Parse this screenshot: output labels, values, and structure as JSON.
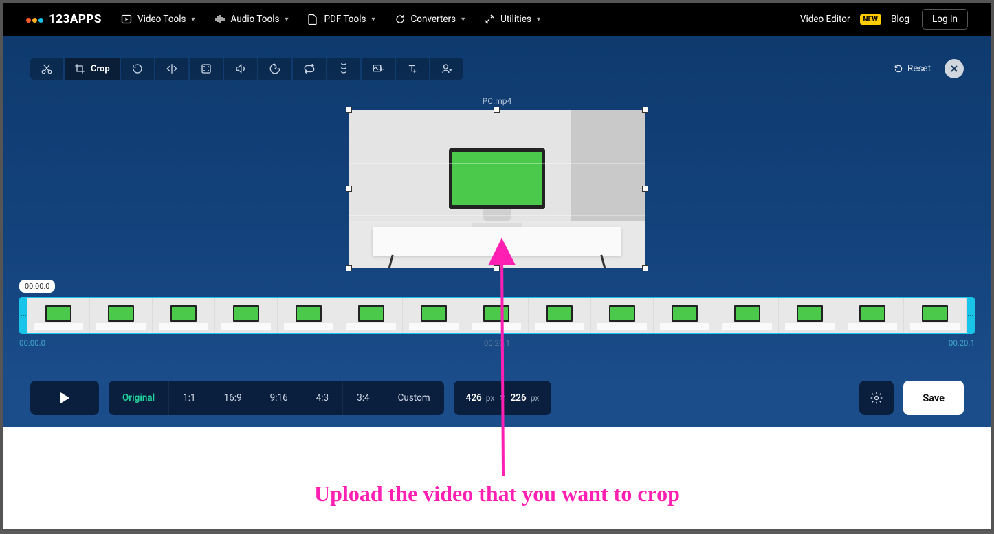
{
  "brand": {
    "name": "123APPS",
    "dot_colors": [
      "#ff5a2c",
      "#ffb01f",
      "#15c2e8"
    ]
  },
  "nav": {
    "video_tools": "Video Tools",
    "audio_tools": "Audio Tools",
    "pdf_tools": "PDF Tools",
    "converters": "Converters",
    "utilities": "Utilities",
    "video_editor": "Video Editor",
    "badge_new": "NEW",
    "blog": "Blog",
    "login": "Log In"
  },
  "toolbar": {
    "crop_label": "Crop",
    "reset_label": "Reset"
  },
  "file": {
    "name": "PC.mp4"
  },
  "timeline": {
    "marker": "00:00.0",
    "start": "00:00.0",
    "mid": "00:20.1",
    "end": "00:20.1",
    "thumb_count": 15
  },
  "ratios": {
    "original": "Original",
    "r11": "1:1",
    "r169": "16:9",
    "r916": "9:16",
    "r43": "4:3",
    "r34": "3:4",
    "custom": "Custom",
    "selected": "original"
  },
  "dimensions": {
    "w": "426",
    "h": "226",
    "unit": "px"
  },
  "actions": {
    "save": "Save"
  },
  "annotation": {
    "text": "Upload the video that you want to crop"
  }
}
